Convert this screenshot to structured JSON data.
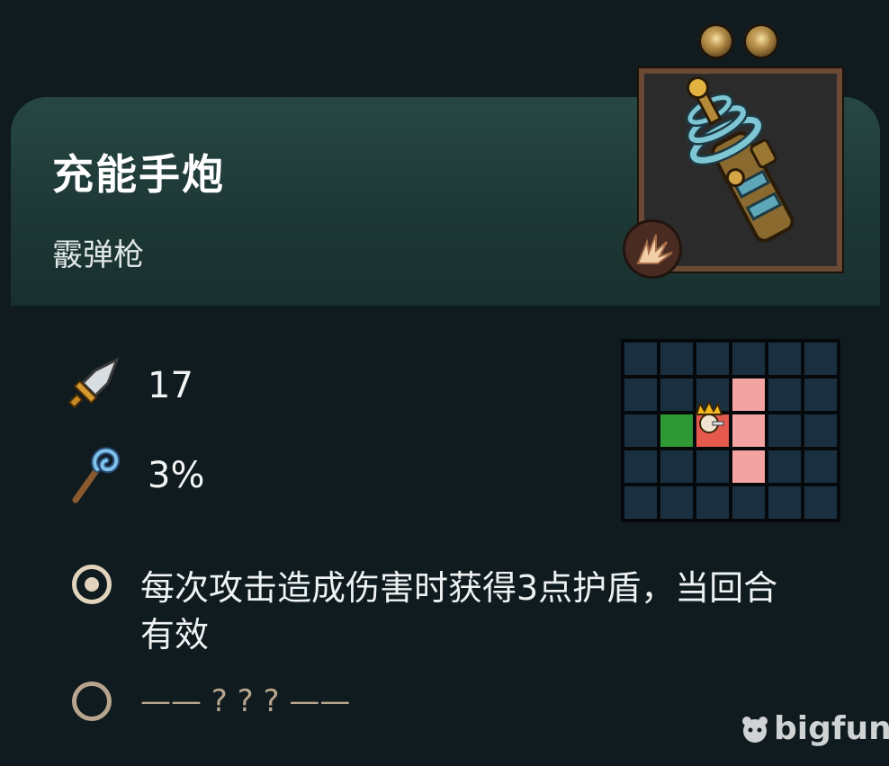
{
  "item": {
    "name": "充能手炮",
    "type": "霰弹枪",
    "icon": "charged-hand-cannon-icon",
    "category_icon": "burst-icon",
    "gem_slots": 2
  },
  "stats": {
    "attack": {
      "icon": "sword-icon",
      "value": "17"
    },
    "crit": {
      "icon": "staff-icon",
      "value": "3%"
    }
  },
  "attack_grid": {
    "cols": 6,
    "rows": 5,
    "player_cell": [
      2,
      2
    ],
    "green_cells": [
      [
        1,
        2
      ]
    ],
    "target_cells": [
      [
        3,
        1
      ],
      [
        3,
        2
      ],
      [
        3,
        3
      ]
    ]
  },
  "effects": [
    {
      "active": true,
      "text": "每次攻击造成伤害时获得3点护盾，当回合有效"
    },
    {
      "active": false,
      "text": "—— ? ? ? ——"
    }
  ],
  "watermark": "bigfun"
}
